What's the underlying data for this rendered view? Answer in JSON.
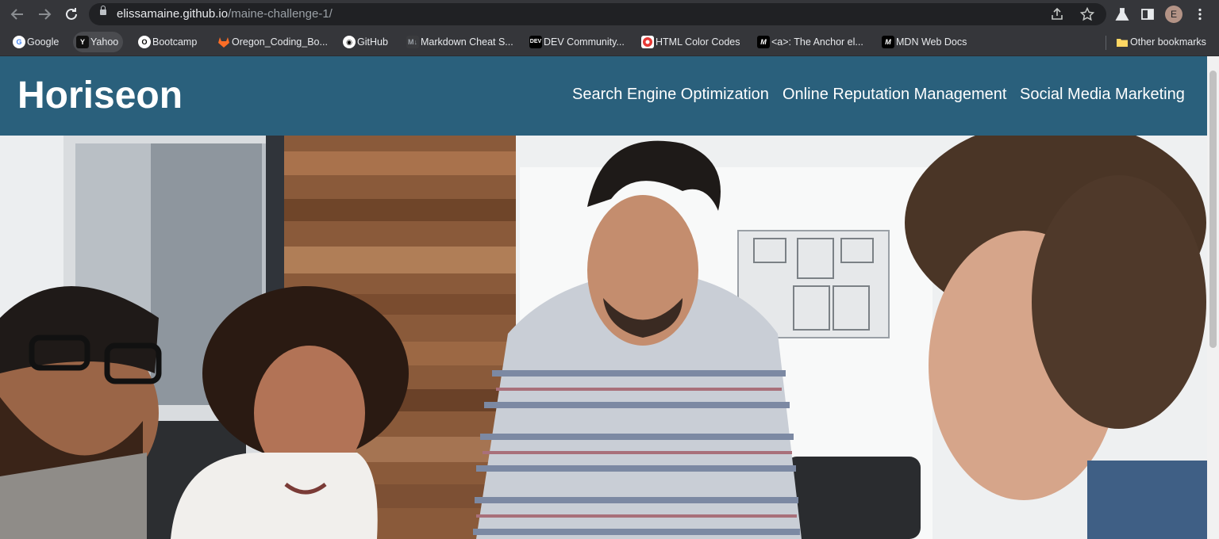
{
  "browser": {
    "url_host": "elissamaine.github.io",
    "url_path": "/maine-challenge-1/",
    "avatar_initial": "E"
  },
  "bookmarks": [
    {
      "label": "Google",
      "icon": "google-icon"
    },
    {
      "label": "Yahoo",
      "icon": "yahoo-icon"
    },
    {
      "label": "Bootcamp",
      "icon": "bootcamp-icon"
    },
    {
      "label": "Oregon_Coding_Bo...",
      "icon": "gitlab-icon"
    },
    {
      "label": "GitHub",
      "icon": "github-icon"
    },
    {
      "label": "Markdown Cheat S...",
      "icon": "markdown-icon"
    },
    {
      "label": "DEV Community...",
      "icon": "dev-icon"
    },
    {
      "label": "HTML Color Codes",
      "icon": "color-codes-icon"
    },
    {
      "label": "<a>: The Anchor el...",
      "icon": "mdn-icon"
    },
    {
      "label": "MDN Web Docs",
      "icon": "mdn-icon"
    }
  ],
  "other_bookmarks": "Other bookmarks",
  "site": {
    "logo": "Horiseon",
    "nav": [
      {
        "label": "Search Engine Optimization"
      },
      {
        "label": "Online Reputation Management"
      },
      {
        "label": "Social Media Marketing"
      }
    ]
  },
  "colors": {
    "header": "#2a607c",
    "chrome": "#35363a",
    "omnibox": "#202124"
  }
}
